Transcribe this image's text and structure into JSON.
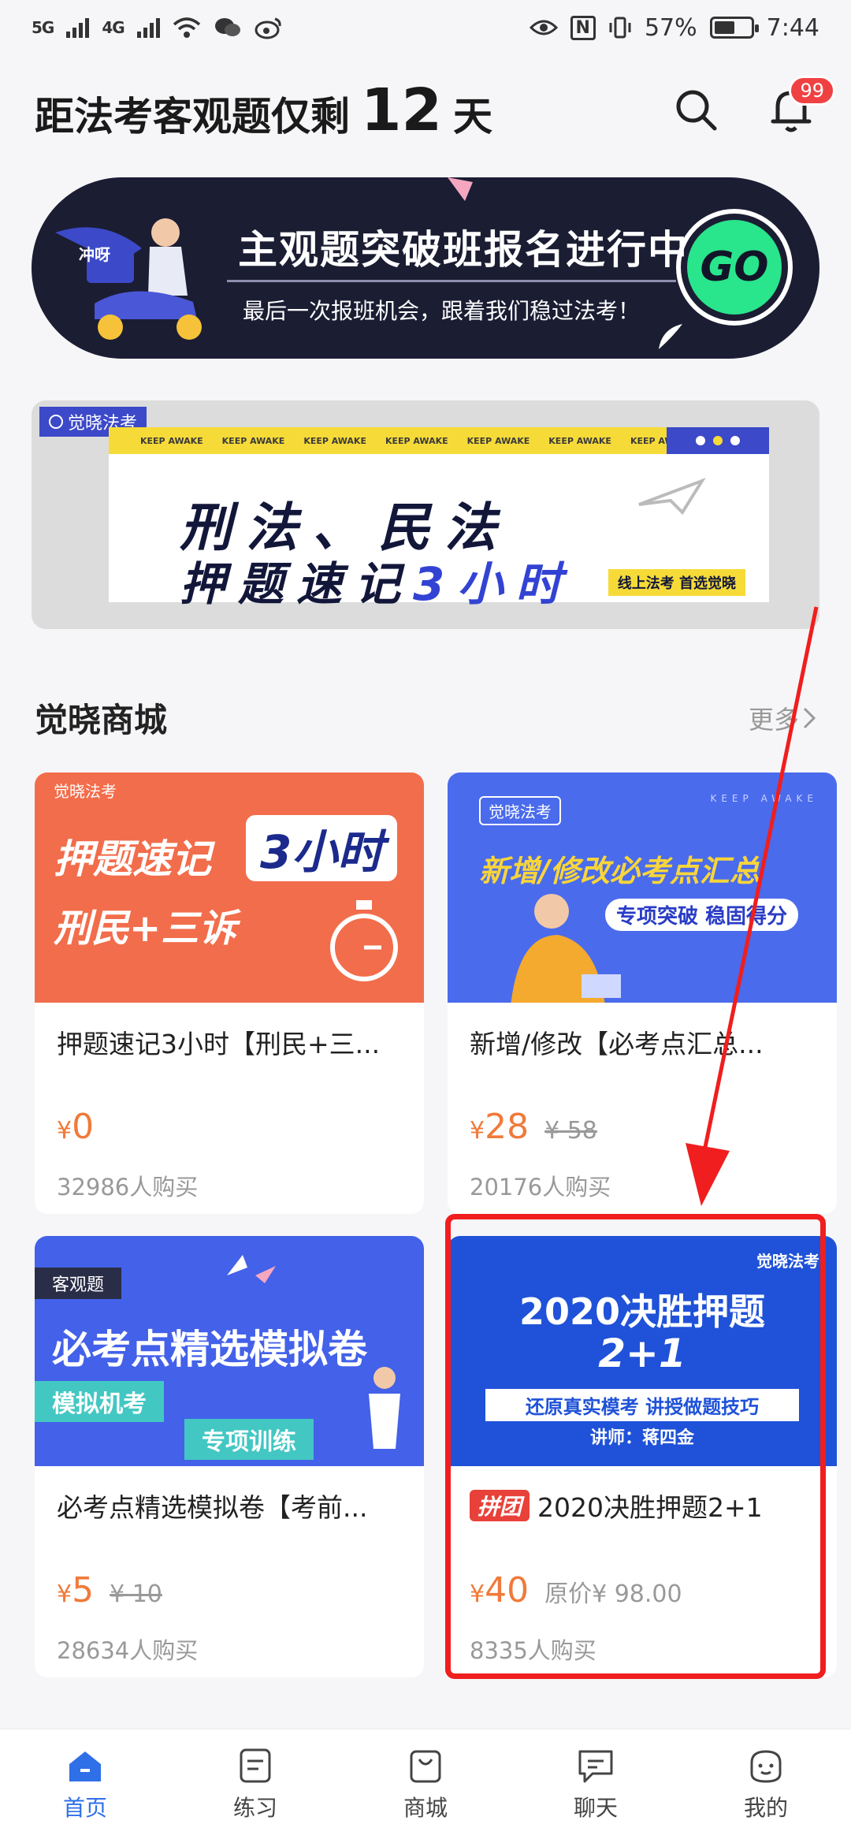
{
  "status": {
    "signal_left_a": "5G",
    "signal_left_b": "4G",
    "battery_percent": "57%",
    "time": "7:44",
    "nfc_label": "N"
  },
  "header": {
    "prefix": "距法考客观题仅剩",
    "days": "12",
    "suffix": "天",
    "notification_count": "99"
  },
  "banner1": {
    "title": "主观题突破班报名进行中",
    "subtitle": "最后一次报班机会，跟着我们稳过法考！",
    "go_label": "GO",
    "rider_tag": "冲呀"
  },
  "banner2": {
    "tag": "觉晓法考",
    "strip_text": "KEEP AWAKE",
    "line1": "刑法、民法",
    "line2_main": "押题速记",
    "line2_accent": "3小时",
    "footer": "线上法考 首选觉晓"
  },
  "shop": {
    "title": "觉晓商城",
    "more_label": "更多",
    "products": [
      {
        "cover_tag": "觉晓法考",
        "cover_line1": "押题速记",
        "cover_accent": "3小时",
        "cover_line2": "刑民+三诉",
        "name": "押题速记3小时【刑民+三...",
        "currency": "¥",
        "price": "0",
        "original_price": "",
        "buyers": "32986人购买",
        "accent": "#f26d4b"
      },
      {
        "cover_tag": "觉晓法考",
        "cover_line1": "新增/修改必考点汇总",
        "cover_accent": "专项突破 稳固得分",
        "cover_line2": "KEEP AWAKE",
        "name": "新增/修改【必考点汇总...",
        "currency": "¥",
        "price": "28",
        "original_price": "¥ 58",
        "buyers": "20176人购买",
        "accent": "#4a6bec"
      },
      {
        "cover_tag": "客观题",
        "cover_line1": "必考点精选模拟卷",
        "cover_accent": "模拟机考",
        "cover_line2": "专项训练",
        "name": "必考点精选模拟卷【考前...",
        "currency": "¥",
        "price": "5",
        "original_price": "¥ 10",
        "buyers": "28634人购买",
        "accent": "#4361e9"
      },
      {
        "cover_tag": "觉晓法考",
        "cover_line1": "2020决胜押题",
        "cover_accent": "2+1",
        "cover_line2": "还原真实模考 讲授做题技巧",
        "cover_teacher": "讲师：蒋四金",
        "group_tag": "拼团",
        "name": "2020决胜押题2+1",
        "currency": "¥",
        "price": "40",
        "original_price": "原价¥ 98.00",
        "buyers": "8335人购买",
        "accent": "#1f52d8"
      }
    ]
  },
  "tabbar": [
    {
      "label": "首页",
      "icon": "home-icon",
      "active": true
    },
    {
      "label": "练习",
      "icon": "practice-icon",
      "active": false
    },
    {
      "label": "商城",
      "icon": "shop-icon",
      "active": false
    },
    {
      "label": "聊天",
      "icon": "chat-icon",
      "active": false
    },
    {
      "label": "我的",
      "icon": "profile-icon",
      "active": false
    }
  ],
  "colors": {
    "accent_blue": "#2f6fe8",
    "price_orange": "#f07a3a",
    "badge_red": "#f04142",
    "highlight_red": "#f01e1e",
    "go_green": "#29e58c"
  }
}
